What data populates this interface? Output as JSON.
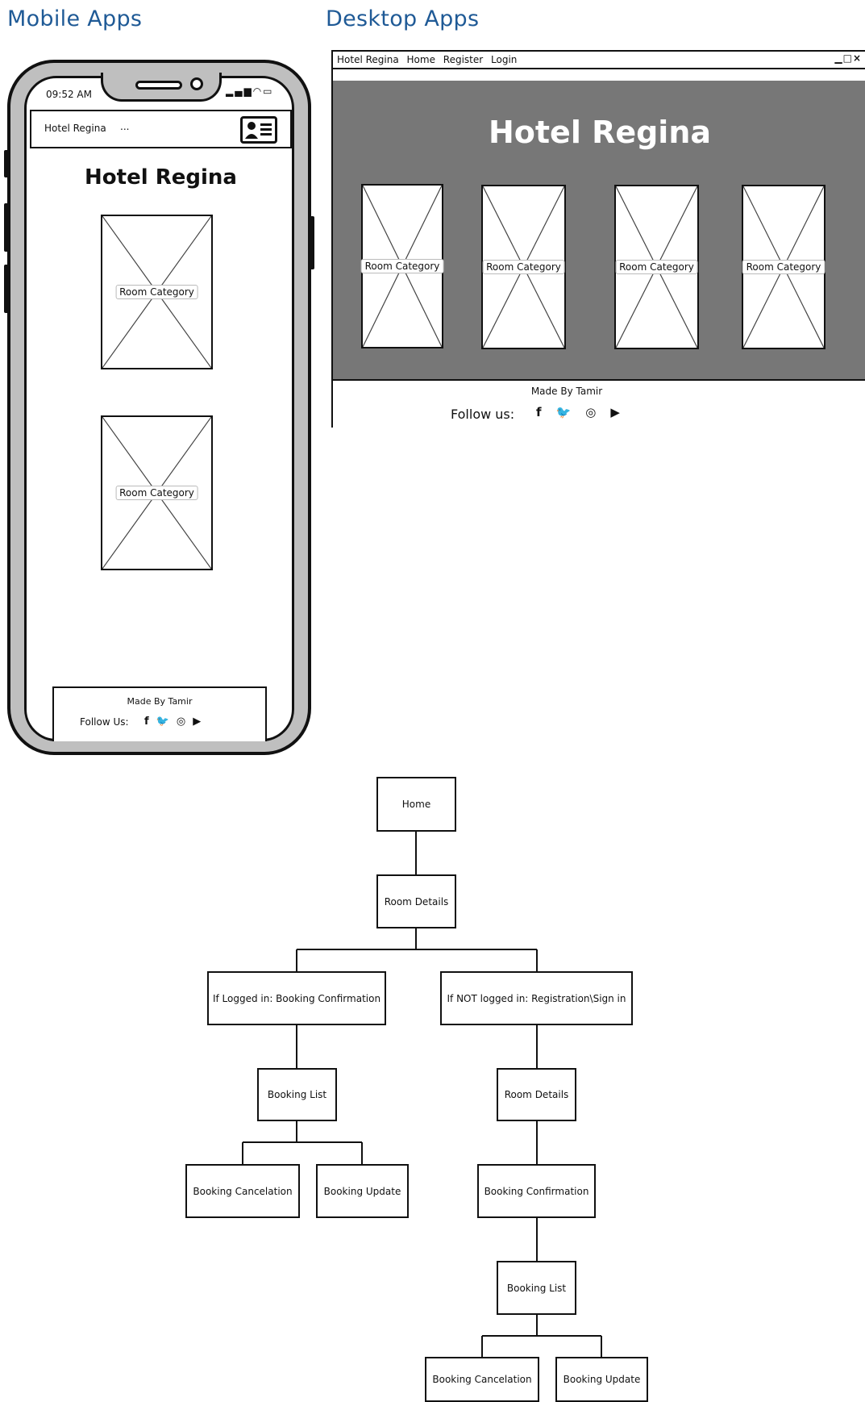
{
  "sections": {
    "mobile_title": "Mobile Apps",
    "desktop_title": "Desktop Apps"
  },
  "mobile": {
    "status_time": "09:52 AM",
    "navbar": {
      "brand": "Hotel Regina",
      "dots": "...",
      "icon": "contact-card-icon"
    },
    "hero_title": "Hotel Regina",
    "cards": [
      "Room Category",
      "Room Category"
    ],
    "footer": {
      "made_by": "Made By Tamir",
      "follow": "Follow Us:",
      "social_icons": [
        "facebook-icon",
        "twitter-icon",
        "instagram-icon",
        "youtube-icon"
      ]
    }
  },
  "desktop": {
    "nav": [
      "Hotel Regina",
      "Home",
      "Register",
      "Login"
    ],
    "hero_title": "Hotel Regina",
    "hero_color": "#777777",
    "cards": [
      "Room Category",
      "Room Category",
      "Room Category",
      "Room Category"
    ],
    "footer": {
      "made_by": "Made By Tamir",
      "follow": "Follow us:",
      "social_icons": [
        "facebook-icon",
        "twitter-icon",
        "instagram-icon",
        "youtube-icon"
      ]
    }
  },
  "sitemap": {
    "home": "Home",
    "room_details": "Room Details",
    "logged_in": "If Logged in: Booking Confirmation",
    "not_logged_in": "If NOT logged in: Registration\\Sign in",
    "left": {
      "booking_list": "Booking List",
      "cancelation": "Booking Cancelation",
      "update": "Booking Update"
    },
    "right": {
      "room_details": "Room Details",
      "booking_confirmation": "Booking Confirmation",
      "booking_list": "Booking List",
      "cancelation": "Booking Cancelation",
      "update": "Booking Update"
    }
  },
  "colors": {
    "section_title": "#1f5a96",
    "frame": "#111111",
    "phone_body": "#bfbfbf"
  }
}
